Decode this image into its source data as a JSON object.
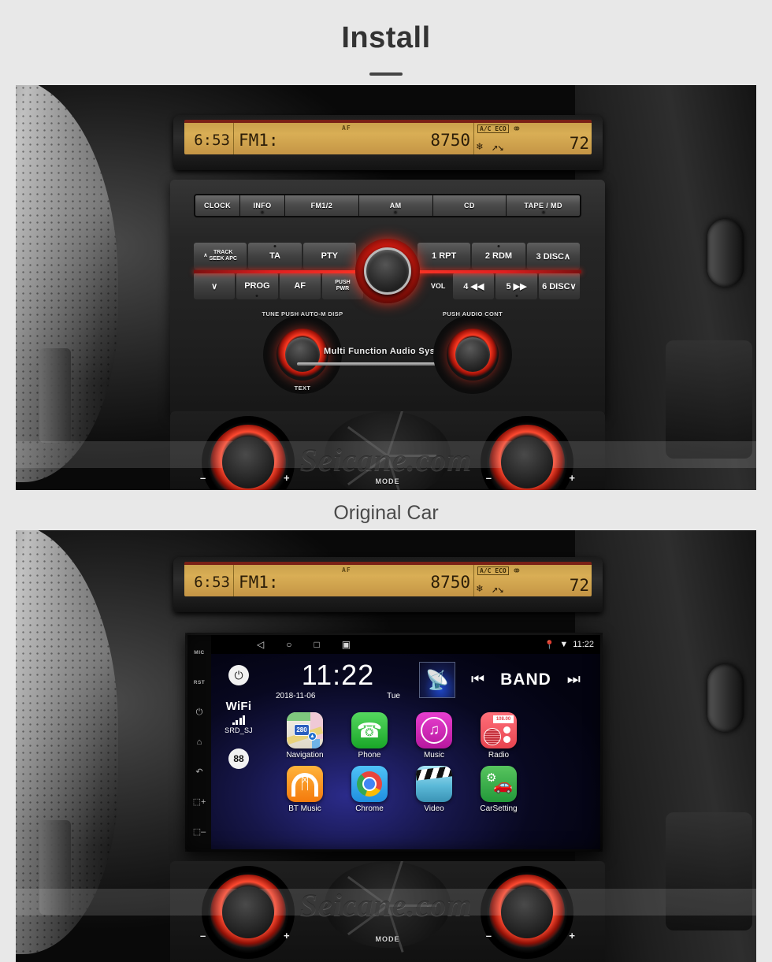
{
  "header": {
    "title": "Install"
  },
  "captions": {
    "original": "Original Car"
  },
  "watermark": {
    "text": "Seicane.com"
  },
  "original_car": {
    "lcd": {
      "time": "6:53",
      "band": "FM1:",
      "frequency": "8750",
      "af_indicator": "AF",
      "ac_eco": "A/C ECO",
      "temperature": "72",
      "fan_icon": "fan-icon",
      "airflow_icon": "airflow-arrows-icon",
      "car_icon": "car-recirculation-icon"
    },
    "source_buttons": [
      {
        "label": "CLOCK",
        "has_led": false
      },
      {
        "label": "INFO",
        "has_led": true
      },
      {
        "label": "FM1/2",
        "has_led": false
      },
      {
        "label": "AM",
        "has_led": true
      },
      {
        "label": "CD",
        "has_led": false
      },
      {
        "label": "TAPE / MD",
        "has_led": true
      }
    ],
    "preset_row_top": [
      {
        "label": "TRACK",
        "sub": "SEEK APC",
        "prefix": "∧"
      },
      {
        "label": "TA"
      },
      {
        "label": "PTY"
      },
      {
        "label": "1 RPT"
      },
      {
        "label": "2 RDM"
      },
      {
        "label": "3 DISC∧"
      }
    ],
    "preset_row_bottom": [
      {
        "label": "∨"
      },
      {
        "label": "PROG"
      },
      {
        "label": "AF"
      },
      {
        "label": "PUSH",
        "sub": "PWR"
      },
      {
        "label": "VOL"
      },
      {
        "label": "4 ◀◀"
      },
      {
        "label": "5 ▶▶"
      },
      {
        "label": "6 DISC∨"
      }
    ],
    "left_knob": {
      "label": "TUNE  PUSH  AUTO-M DISP",
      "sub_label": "TEXT"
    },
    "right_knob": {
      "label": "PUSH  AUDIO CONT"
    },
    "multi_function": "Multi   Function   Audio   System",
    "climate": {
      "mode_label": "MODE",
      "fan_icon": "fan-blades-icon",
      "temp_icon": "temperature-icon",
      "minus": "–",
      "plus": "+",
      "defrost_icon": "defrost-icon"
    }
  },
  "head_unit": {
    "hard_keys": [
      {
        "name": "mic-key",
        "label": "MIC"
      },
      {
        "name": "reset-key",
        "label": "RST"
      },
      {
        "name": "power-key",
        "label": "⏻"
      },
      {
        "name": "home-key",
        "label": "⌂"
      },
      {
        "name": "back-key",
        "label": "↶"
      },
      {
        "name": "volume-up-key",
        "label": "⬚+"
      },
      {
        "name": "volume-down-key",
        "label": "⬚–"
      }
    ],
    "status_bar": {
      "nav_back": "◁",
      "nav_home": "○",
      "nav_recents": "□",
      "nav_screenshot": "▣",
      "location_icon": "location-pin-icon",
      "wifi_icon": "wifi-icon",
      "time": "11:22"
    },
    "power_button": "⏻",
    "wifi_widget": {
      "title": "WiFi",
      "ssid": "SRD_SJ",
      "signal_icon": "signal-bars-icon"
    },
    "badge": "88",
    "clock_widget": {
      "time": "11:22",
      "date": "2018-11-06",
      "weekday": "Tue"
    },
    "media_controls": {
      "thumb_icon": "radio-antenna-icon",
      "prev": "⏮",
      "band": "BAND",
      "next": "⏭"
    },
    "apps_row1": [
      {
        "label": "Navigation",
        "icon": "map-icon",
        "shield": "280",
        "pin": "▲"
      },
      {
        "label": "Phone",
        "icon": "phone-handset-icon",
        "glyph": "✆"
      },
      {
        "label": "Music",
        "icon": "music-note-icon",
        "glyph": "♫"
      },
      {
        "label": "Radio",
        "icon": "radio-icon",
        "display": "108.00"
      }
    ],
    "apps_row2": [
      {
        "label": "BT Music",
        "icon": "bluetooth-headphones-icon",
        "glyph": "ᛗ"
      },
      {
        "label": "Chrome",
        "icon": "chrome-browser-icon"
      },
      {
        "label": "Video",
        "icon": "clapperboard-icon"
      },
      {
        "label": "CarSetting",
        "icon": "car-settings-icon",
        "gear": "⚙",
        "car": "🚗"
      }
    ]
  },
  "colors": {
    "page_background": "#e8e8e8",
    "title": "#333333",
    "lcd_amber": "#d0a54e",
    "accent_red": "#e02020",
    "android_blue": "#1b1b55"
  }
}
